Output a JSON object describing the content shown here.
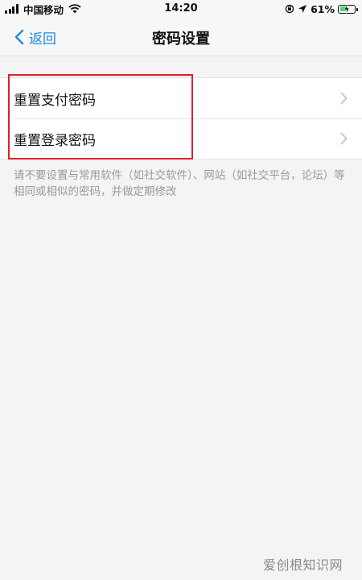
{
  "status_bar": {
    "carrier": "中国移动",
    "time": "14:20",
    "battery_percent": "61%",
    "battery_level": 0.61
  },
  "nav": {
    "back_label": "返回",
    "title": "密码设置"
  },
  "list": {
    "items": [
      {
        "label": "重置支付密码"
      },
      {
        "label": "重置登录密码"
      }
    ]
  },
  "hint": "请不要设置与常用软件（如社交软件）、网站（如社交平台，论坛）等相同或相似的密码，并做定期修改",
  "watermark": "爱创根知识网",
  "colors": {
    "accent": "#1a89e8",
    "highlight": "#e0202a"
  }
}
